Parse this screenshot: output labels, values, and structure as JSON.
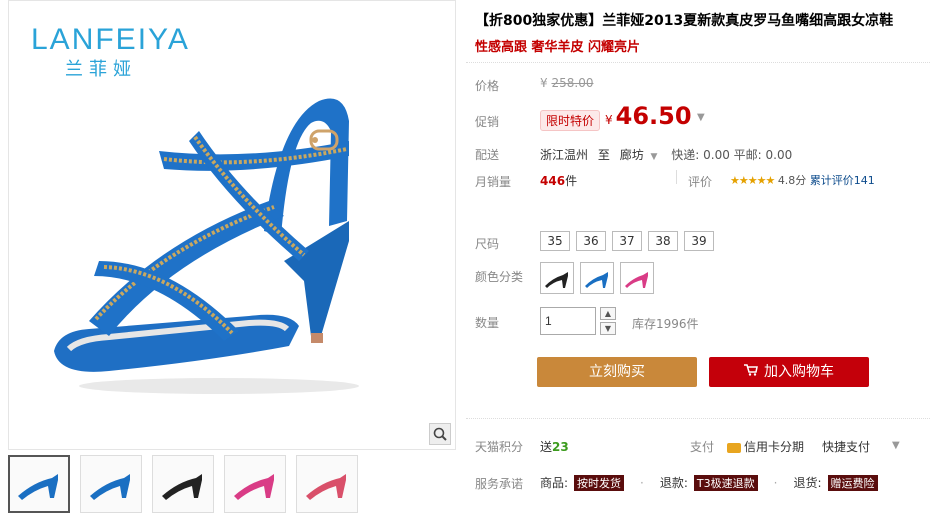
{
  "brand": {
    "logo_en": "LANFEIYA",
    "logo_cn": "兰菲娅"
  },
  "product": {
    "title": "【折800独家优惠】兰菲娅2013夏新款真皮罗马鱼嘴细高跟女凉鞋",
    "subtitle": "性感高跟 奢华羊皮 闪耀亮片"
  },
  "labels": {
    "price": "价格",
    "promo": "促销",
    "delivery": "配送",
    "monthly_sales": "月销量",
    "rating": "评价",
    "size": "尺码",
    "color": "颜色分类",
    "quantity": "数量",
    "tmall_points": "天猫积分",
    "payment": "支付",
    "service": "服务承诺"
  },
  "price": {
    "original_currency": "¥",
    "original": "258.00",
    "promo_tag": "限时特价",
    "currency": "¥",
    "current": "46.50"
  },
  "delivery": {
    "from": "浙江温州",
    "to_word": "至",
    "to": "廊坊",
    "fees": "快递: 0.00 平邮: 0.00"
  },
  "sales": {
    "count": "446",
    "unit": "件"
  },
  "rating": {
    "stars": "★★★★★",
    "score": "4.8分",
    "count_text": "累计评价141"
  },
  "sizes": [
    "35",
    "36",
    "37",
    "38",
    "39"
  ],
  "colors": [
    {
      "name": "black",
      "hex": "#222222"
    },
    {
      "name": "blue",
      "hex": "#1a6fc2"
    },
    {
      "name": "pink",
      "hex": "#d93c86"
    }
  ],
  "quantity": {
    "value": "1",
    "stock": "库存1996件"
  },
  "buttons": {
    "buy_now": "立刻购买",
    "add_cart": "加入购物车"
  },
  "points": {
    "prefix": "送",
    "value": "23"
  },
  "payment": {
    "card": "信用卡分期",
    "quick": "快捷支付"
  },
  "service": {
    "item1_label": "商品:",
    "item1_tag": "按时发货",
    "item2_label": "退款:",
    "item2_tag": "T3极速退款",
    "item3_label": "退货:",
    "item3_tag": "赠运费险"
  },
  "thumb_colors": [
    "#1a6fc2",
    "#1a6fc2",
    "#222222",
    "#d93c86",
    "#d9506a"
  ]
}
